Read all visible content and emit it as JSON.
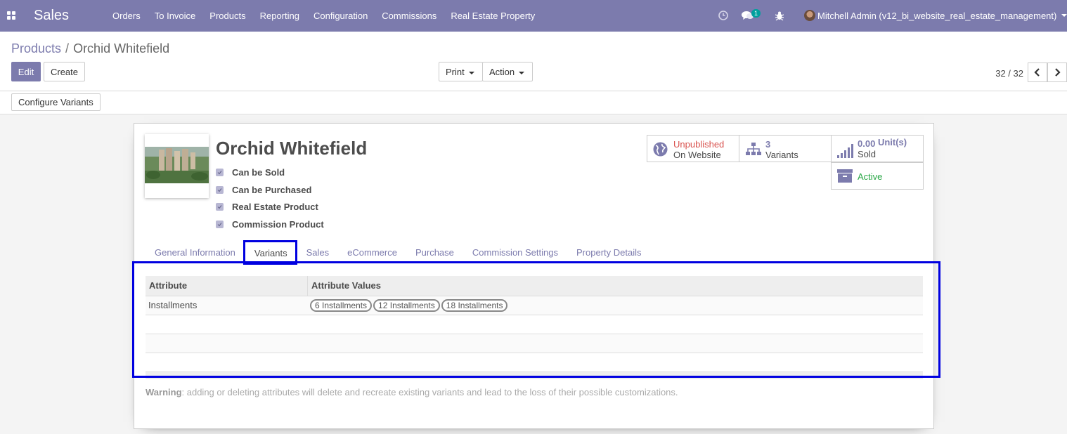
{
  "navbar": {
    "brand": "Sales",
    "menu": [
      "Orders",
      "To Invoice",
      "Products",
      "Reporting",
      "Configuration",
      "Commissions",
      "Real Estate Property"
    ],
    "messages_count": "1",
    "user": "Mitchell Admin (v12_bi_website_real_estate_management)"
  },
  "breadcrumb": {
    "parent": "Products",
    "separator": "/",
    "current": "Orchid Whitefield"
  },
  "buttons": {
    "edit": "Edit",
    "create": "Create",
    "print": "Print",
    "action": "Action",
    "configure_variants": "Configure Variants"
  },
  "pager": {
    "value": "32 / 32"
  },
  "product": {
    "name": "Orchid Whitefield",
    "flags": [
      {
        "label": "Can be Sold",
        "checked": true
      },
      {
        "label": "Can be Purchased",
        "checked": true
      },
      {
        "label": "Real Estate Product",
        "checked": true
      },
      {
        "label": "Commission Product",
        "checked": true
      }
    ]
  },
  "smart_buttons": {
    "website": {
      "status": "Unpublished",
      "label": "On Website",
      "status_color": "#d9534f"
    },
    "variants": {
      "count": "3",
      "label": "Variants"
    },
    "sold": {
      "value": "0.00",
      "unit": "Unit(s)",
      "label": "Sold"
    },
    "active": {
      "label": "Active",
      "color": "#28a745"
    }
  },
  "tabs": [
    "General Information",
    "Variants",
    "Sales",
    "eCommerce",
    "Purchase",
    "Commission Settings",
    "Property Details"
  ],
  "active_tab": "Variants",
  "table": {
    "headers": [
      "Attribute",
      "Attribute Values"
    ],
    "rows": [
      {
        "attribute": "Installments",
        "values": [
          "6 Installments",
          "12 Installments",
          "18 Installments"
        ]
      }
    ]
  },
  "warning": {
    "bold": "Warning",
    "text": ": adding or deleting attributes will delete and recreate existing variants and lead to the loss of their possible customizations."
  },
  "colors": {
    "brand": "#7c7bad",
    "highlight": "#0000e0"
  }
}
